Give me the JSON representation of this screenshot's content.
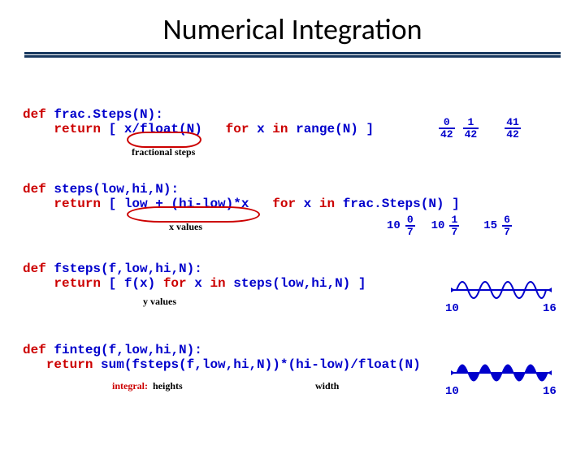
{
  "title": "Numerical Integration",
  "kw": {
    "def": "def",
    "ret": "return",
    "for": "for",
    "in": "in"
  },
  "fn1": {
    "sig": " frac.Steps(N):",
    "body0": " [ x/float(N)",
    "body1": " x ",
    "body2": " range(N) ]",
    "annot": "fractional steps",
    "seq0_num": "0",
    "seq0_den": "42",
    "seq1_num": "1",
    "seq1_den": "42",
    "dots": "…",
    "seqN_num": "41",
    "seqN_den": "42"
  },
  "fn2": {
    "sig": " steps(low,hi,N):",
    "body0": " [ low + (hi-low)*x",
    "body1": " x ",
    "body2": " frac.Steps(N) ]",
    "annot": "x values",
    "base": "10",
    "seq0_num": "0",
    "seq0_den": "7",
    "seq1_num": "1",
    "seq1_den": "7",
    "dots": "…",
    "seqN_num": "6",
    "seqN_den": "7",
    "seqN_pre": "15"
  },
  "fn3": {
    "sig": " fsteps(f,low,hi,N):",
    "body0": " [ f(x) ",
    "body1": " x ",
    "body2": " steps(low,hi,N) ]",
    "annot": "y values",
    "lo": "10",
    "hi": "16"
  },
  "fn4": {
    "sig": " finteg(f,low,hi,N):",
    "body0": " sum(fsteps(f,low,hi,N))*(hi-low)/float(N)",
    "annot1": "integral:",
    "annot2": "heights",
    "annot3": "width",
    "lo": "10",
    "hi": "16"
  }
}
